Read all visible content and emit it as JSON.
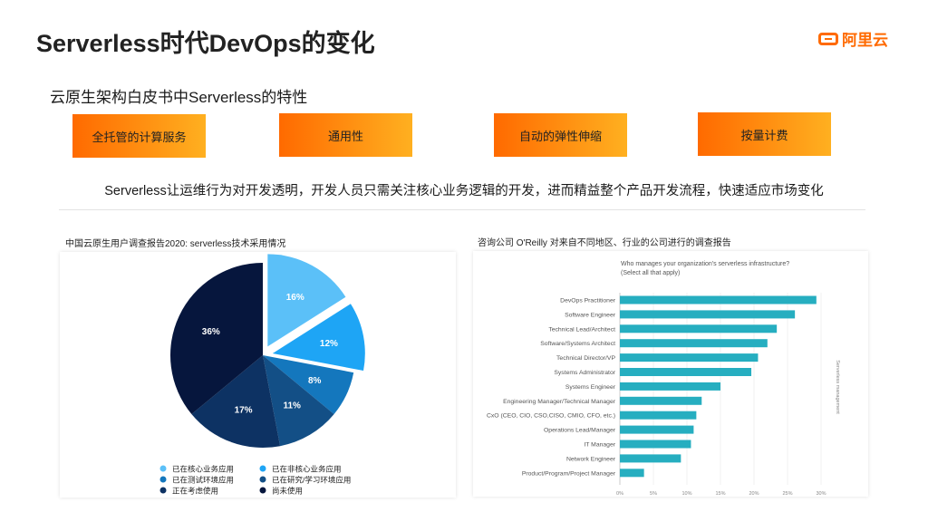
{
  "title": "Serverless时代DevOps的变化",
  "logo": {
    "text": "阿里云",
    "color": "#ff6a00"
  },
  "subtitle": "云原生架构白皮书中Serverless的特性",
  "features": [
    "全托管的计算服务",
    "通用性",
    "自动的弹性伸缩",
    "按量计费"
  ],
  "summary": "Serverless让运维行为对开发透明，开发人员只需关注核心业务逻辑的开发，进而精益整个产品开发流程，快速适应市场变化",
  "left_caption": "中国云原生用户调查报告2020: serverless技术采用情况",
  "right_caption": "咨询公司 O'Reilly  对来自不同地区、行业的公司进行的调查报告",
  "chart_data": [
    {
      "type": "pie",
      "title": "中国云原生用户调查报告2020: serverless技术采用情况",
      "legend_position": "bottom",
      "slices": [
        {
          "label": "已在核心业务应用",
          "value": 16,
          "display": "16%",
          "color": "#5bc0f8",
          "exploded": true
        },
        {
          "label": "已在非核心业务应用",
          "value": 12,
          "display": "12%",
          "color": "#1ea5f5",
          "exploded": true
        },
        {
          "label": "已在测试环境应用",
          "value": 8,
          "display": "8%",
          "color": "#1477bd",
          "exploded": false
        },
        {
          "label": "已在研究/学习环境应用",
          "value": 11,
          "display": "11%",
          "color": "#134f86",
          "exploded": false
        },
        {
          "label": "正在考虑使用",
          "value": 17,
          "display": "17%",
          "color": "#0d3263",
          "exploded": false
        },
        {
          "label": "尚未使用",
          "value": 36,
          "display": "36%",
          "color": "#06163d",
          "exploded": false
        }
      ]
    },
    {
      "type": "bar",
      "orientation": "horizontal",
      "title": "Who manages your organization's serverless infrastructure?",
      "subtitle": "(Select all that apply)",
      "side_label": "Serverless management",
      "color": "#26aec0",
      "categories": [
        "DevOps Practitioner",
        "Software Engineer",
        "Technical Lead/Architect",
        "Software/Systems Architect",
        "Technical Director/VP",
        "Systems Administrator",
        "Systems Engineer",
        "Engineering Manager/Technical Manager",
        "CxO (CEO, CIO, CSO,CISO, CMIO, CFO, etc.)",
        "Operations Lead/Manager",
        "IT Manager",
        "Network Engineer",
        "Product/Program/Project Manager"
      ],
      "values": [
        29.3,
        26.1,
        23.4,
        22.0,
        20.6,
        19.6,
        15.0,
        12.2,
        11.4,
        11.0,
        10.6,
        9.1,
        3.6
      ],
      "xlim": [
        0,
        30
      ],
      "xticks": [
        "0%",
        "5%",
        "10%",
        "15%",
        "20%",
        "25%",
        "30%"
      ],
      "grid": true
    }
  ]
}
